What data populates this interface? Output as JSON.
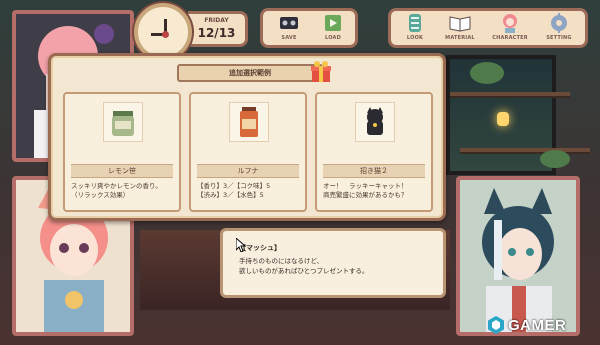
{
  "hud": {
    "day": "FRIDAY",
    "date": "12/13",
    "buttons": [
      {
        "label": "SAVE",
        "icon": "save-icon"
      },
      {
        "label": "LOAD",
        "icon": "load-icon"
      },
      {
        "label": "LOOK",
        "icon": "look-icon"
      },
      {
        "label": "MATERIAL",
        "icon": "book-icon"
      },
      {
        "label": "CHARACTER",
        "icon": "character-icon"
      },
      {
        "label": "SETTING",
        "icon": "gear-icon"
      }
    ]
  },
  "panel": {
    "title": "追加選択範例",
    "cards": [
      {
        "name": "レモン笹",
        "icon": "jar-icon",
        "desc": [
          "スッキリ爽やかレモンの香り。",
          "（リラックス効果）"
        ]
      },
      {
        "name": "ルフナ",
        "icon": "tea-can-icon",
        "desc": [
          "【香り】3／【コク味】5",
          "【渋み】3／【水色】5"
        ]
      },
      {
        "name": "招き猫２",
        "icon": "lucky-cat-icon",
        "desc": [
          "オー！　ラッキーキャット！",
          "商売繁盛に効果があるかも？"
        ]
      }
    ]
  },
  "dialog": {
    "speaker": "【マッシュ】",
    "lines": [
      "手持ちのものにはなるけど、",
      "欲しいものがあればひとつプレゼントする。"
    ]
  },
  "watermark": {
    "text": "GAMER"
  },
  "colors": {
    "frame": "#b46d68",
    "panel": "#f4e7d1",
    "accent": "#e4503f"
  }
}
